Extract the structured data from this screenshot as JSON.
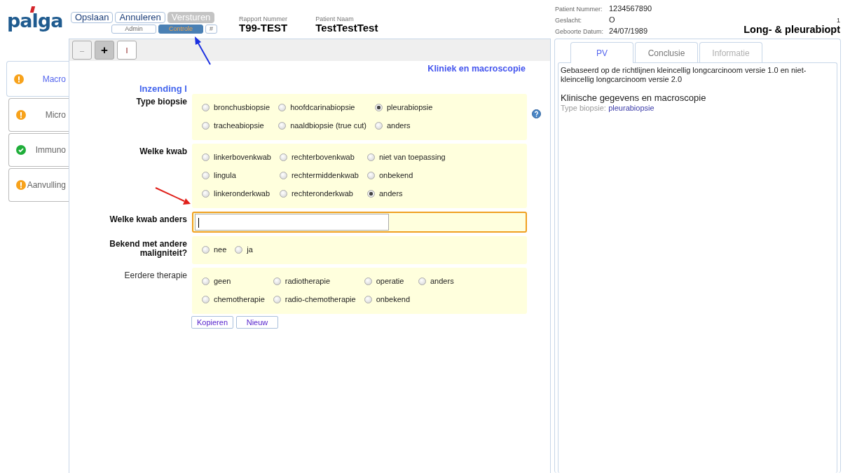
{
  "logo": "palga",
  "header": {
    "buttons": [
      {
        "label": "Opslaan",
        "disabled": false
      },
      {
        "label": "Annuleren",
        "disabled": false
      },
      {
        "label": "Versturen",
        "disabled": true
      }
    ],
    "sub_buttons": [
      {
        "label": "Admin",
        "selected": false
      },
      {
        "label": "Controle",
        "selected": true
      },
      {
        "label": "#",
        "selected": false
      }
    ],
    "report": [
      {
        "label": "Rapport Nummer",
        "value": "T99-TEST"
      },
      {
        "label": "Patient Naam",
        "value": "TestTestTest"
      }
    ],
    "patient": [
      {
        "label": "Patient Nummer:",
        "value": "1234567890"
      },
      {
        "label": "Geslacht:",
        "value": "O"
      },
      {
        "label": "Geboorte Datum:",
        "value": "24/07/1989"
      }
    ],
    "page_number": "1",
    "protocol": "Long- & pleurabiopt"
  },
  "sidebar": {
    "items": [
      {
        "label": "Macro",
        "kind": "warning",
        "selected": true
      },
      {
        "label": "Micro",
        "kind": "warning",
        "selected": false
      },
      {
        "label": "Immuno",
        "kind": "ok",
        "selected": false
      },
      {
        "label": "Aanvulling",
        "kind": "warning",
        "selected": false
      }
    ]
  },
  "toolbar": [
    {
      "label": "–",
      "disabled": true,
      "pressed": false
    },
    {
      "label": "+",
      "disabled": false,
      "pressed": true
    },
    {
      "label": "I",
      "disabled": false,
      "pressed": false
    }
  ],
  "form": {
    "section_title": "Kliniek en macroscopie",
    "subtitle": "Inzending I",
    "groups": [
      {
        "kind": "radio",
        "label": "Type biopsie",
        "required": true,
        "help": true,
        "focused": false,
        "rows": [
          [
            {
              "label": "bronchusbiopsie",
              "selected": false
            },
            {
              "label": "hoofdcarinabiopsie",
              "selected": false
            },
            {
              "label": "pleurabiopsie",
              "selected": true
            }
          ],
          [
            {
              "label": "tracheabiopsie",
              "selected": false
            },
            {
              "label": "naaldbiopsie (true cut)",
              "selected": false
            },
            {
              "label": "anders",
              "selected": false
            }
          ]
        ]
      },
      {
        "kind": "radio",
        "label": "Welke kwab",
        "required": true,
        "help": false,
        "focused": false,
        "rows": [
          [
            {
              "label": "linkerbovenkwab",
              "selected": false
            },
            {
              "label": "rechterbovenkwab",
              "selected": false
            },
            {
              "label": "niet van toepassing",
              "selected": false
            }
          ],
          [
            {
              "label": "lingula",
              "selected": false
            },
            {
              "label": "rechtermiddenkwab",
              "selected": false
            },
            {
              "label": "onbekend",
              "selected": false
            }
          ],
          [
            {
              "label": "linkeronderkwab",
              "selected": false
            },
            {
              "label": "rechteronderkwab",
              "selected": false
            },
            {
              "label": "anders",
              "selected": true
            }
          ]
        ]
      },
      {
        "kind": "text",
        "label": "Welke kwab anders",
        "required": true,
        "help": false,
        "focused": true
      },
      {
        "kind": "radio",
        "label": "Bekend met andere maligniteit?",
        "required": true,
        "help": false,
        "focused": false,
        "rows": [
          [
            {
              "label": "nee",
              "selected": false
            },
            {
              "label": "ja",
              "selected": false
            }
          ]
        ]
      },
      {
        "kind": "radio",
        "label": "Eerdere therapie",
        "required": false,
        "help": false,
        "focused": false,
        "rows": [
          [
            {
              "label": "geen",
              "selected": false
            },
            {
              "label": "radiotherapie",
              "selected": false
            },
            {
              "label": "operatie",
              "selected": false
            },
            {
              "label": "anders",
              "selected": false
            }
          ],
          [
            {
              "label": "chemotherapie",
              "selected": false
            },
            {
              "label": "radio-chemotherapie",
              "selected": false
            },
            {
              "label": "onbekend",
              "selected": false
            }
          ]
        ]
      }
    ],
    "buttons": [
      "Kopieren",
      "Nieuw"
    ]
  },
  "preview": {
    "tabs": [
      {
        "label": "PV",
        "selected": true,
        "disabled": false
      },
      {
        "label": "Conclusie",
        "selected": false,
        "disabled": false
      },
      {
        "label": "Informatie",
        "selected": false,
        "disabled": true
      }
    ],
    "intro": "Gebaseerd op de richtlijnen kleincellig longcarcinoom versie 1.0 en niet-kleincellig longcarcinoom versie 2.0",
    "heading": "Klinische gegevens en macroscopie",
    "fields": [
      {
        "label": "Type biopsie:",
        "value": "pleurabiopsie"
      }
    ]
  }
}
